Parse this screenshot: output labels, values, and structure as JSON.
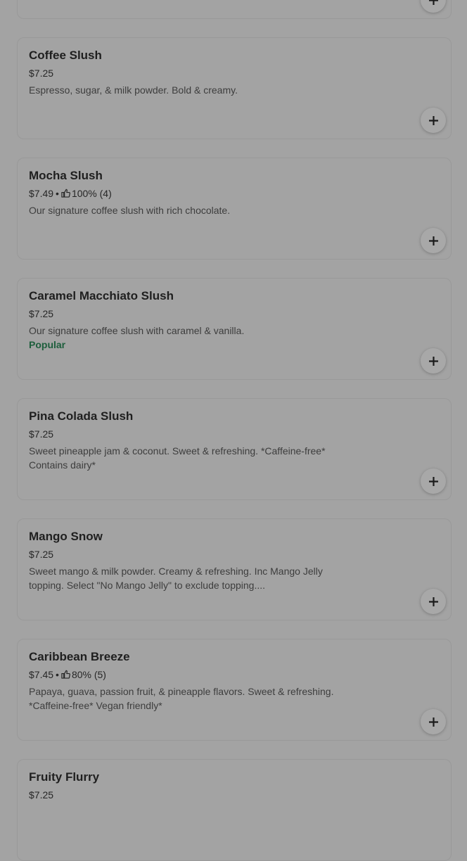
{
  "items": [
    {
      "title": "Coffee Slush",
      "price": "$7.25",
      "rating": "",
      "description": "Espresso, sugar, & milk powder. Bold & creamy.",
      "badge": ""
    },
    {
      "title": "Mocha Slush",
      "price": "$7.49",
      "rating": "100% (4)",
      "description": "Our signature coffee slush with rich chocolate.",
      "badge": ""
    },
    {
      "title": "Caramel Macchiato Slush",
      "price": "$7.25",
      "rating": "",
      "description": "Our signature coffee slush with caramel & vanilla.",
      "badge": "Popular"
    },
    {
      "title": "Pina Colada Slush",
      "price": "$7.25",
      "rating": "",
      "description": "Sweet pineapple jam & coconut. Sweet & refreshing. *Caffeine-free* Contains dairy*",
      "badge": ""
    },
    {
      "title": "Mango Snow",
      "price": "$7.25",
      "rating": "",
      "description": "Sweet mango & milk powder. Creamy & refreshing. Inc Mango Jelly topping. Select \"No Mango Jelly\" to exclude topping....",
      "badge": ""
    },
    {
      "title": "Caribbean Breeze",
      "price": "$7.45",
      "rating": "80% (5)",
      "description": "Papaya, guava, passion fruit, & pineapple flavors. Sweet & refreshing. *Caffeine-free* Vegan friendly*",
      "badge": ""
    },
    {
      "title": "Fruity Flurry",
      "price": "$7.25",
      "rating": "",
      "description": "",
      "badge": ""
    }
  ],
  "separator": "•",
  "add_icon": "plus-icon",
  "rating_icon": "thumbs-up-icon",
  "colors": {
    "popular": "#1d5e3c"
  }
}
